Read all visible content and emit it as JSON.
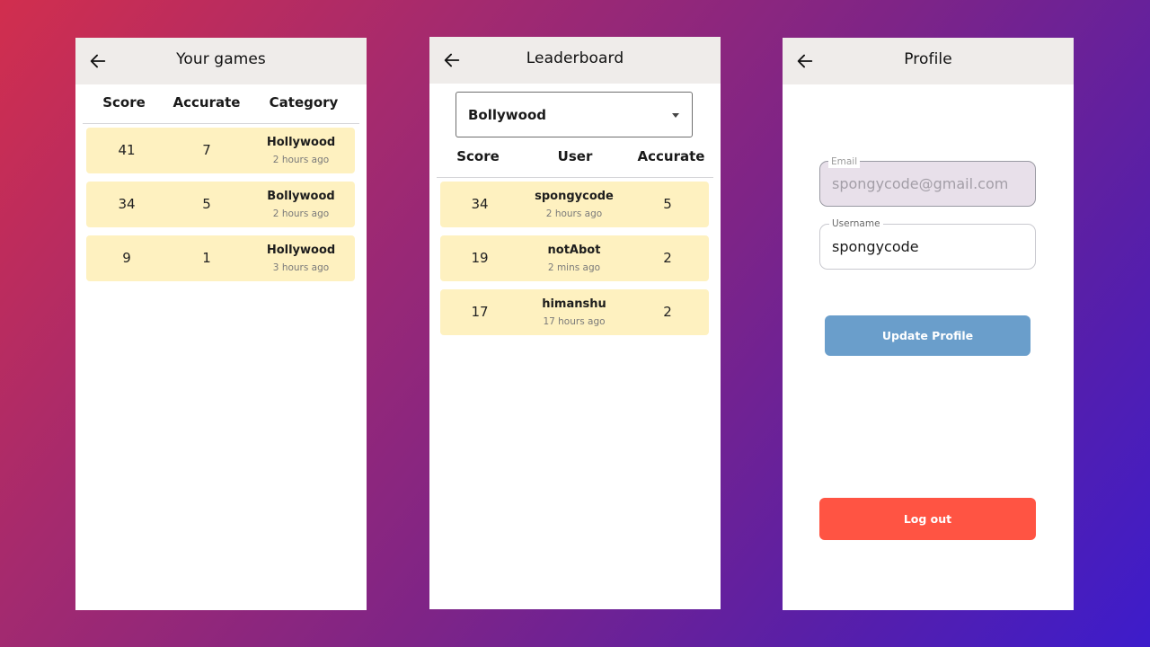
{
  "colors": {
    "row_bg": "#fef1c0",
    "appbar_bg": "#efecea",
    "update_button": "#6a9ecb",
    "logout_button": "#ff5443",
    "email_field_bg": "#e8e0ea"
  },
  "games": {
    "title": "Your games",
    "back_icon": "arrow-left-icon",
    "columns": [
      "Score",
      "Accurate",
      "Category"
    ],
    "rows": [
      {
        "score": "41",
        "accurate": "7",
        "category": "Hollywood",
        "time": "2 hours ago"
      },
      {
        "score": "34",
        "accurate": "5",
        "category": "Bollywood",
        "time": "2 hours ago"
      },
      {
        "score": "9",
        "accurate": "1",
        "category": "Hollywood",
        "time": "3 hours ago"
      }
    ]
  },
  "leaderboard": {
    "title": "Leaderboard",
    "back_icon": "arrow-left-icon",
    "category_select": {
      "value": "Bollywood",
      "icon": "caret-down-icon"
    },
    "columns": [
      "Score",
      "User",
      "Accurate"
    ],
    "rows": [
      {
        "score": "34",
        "user": "spongycode",
        "time": "2 hours ago",
        "accurate": "5"
      },
      {
        "score": "19",
        "user": "notAbot",
        "time": "2 mins ago",
        "accurate": "2"
      },
      {
        "score": "17",
        "user": "himanshu",
        "time": "17 hours ago",
        "accurate": "2"
      }
    ]
  },
  "profile": {
    "title": "Profile",
    "back_icon": "arrow-left-icon",
    "email": {
      "label": "Email",
      "value": "spongycode@gmail.com"
    },
    "username": {
      "label": "Username",
      "value": "spongycode"
    },
    "update_button": "Update Profile",
    "logout_button": "Log out"
  }
}
